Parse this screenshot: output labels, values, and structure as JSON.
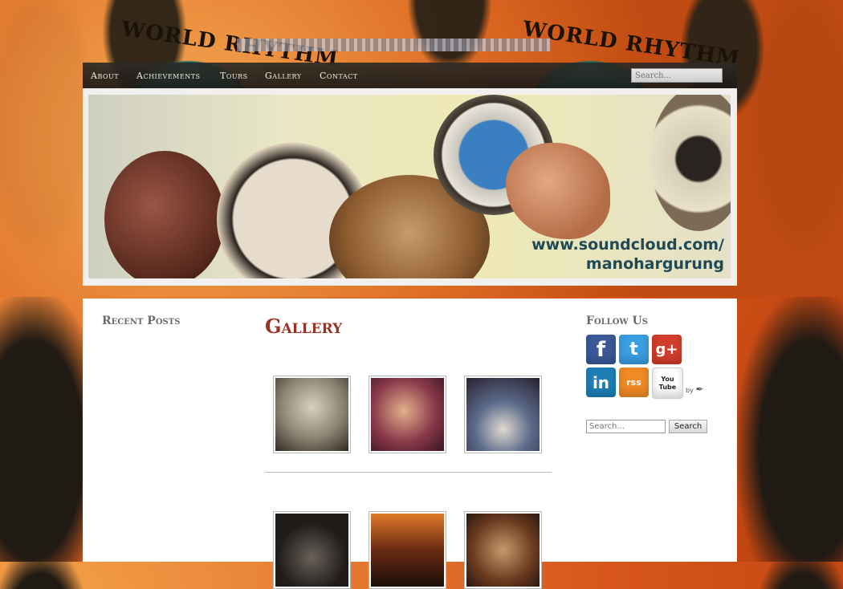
{
  "header": {
    "logo_text": "WORLD RHYTHM",
    "search_placeholder": "Search..."
  },
  "nav": {
    "items": [
      {
        "label": "About"
      },
      {
        "label": "Achievements"
      },
      {
        "label": "Tours"
      },
      {
        "label": "Gallery"
      },
      {
        "label": "Contact"
      }
    ]
  },
  "banner": {
    "line1": "www.soundcloud.com/",
    "line2": "manohargurung"
  },
  "sidebar_left": {
    "title": "Recent Posts"
  },
  "main": {
    "title": "Gallery",
    "row1": [
      {
        "name": "photo-1"
      },
      {
        "name": "photo-2"
      },
      {
        "name": "photo-3"
      }
    ],
    "row2": [
      {
        "name": "photo-4"
      },
      {
        "name": "photo-5"
      },
      {
        "name": "photo-6"
      }
    ]
  },
  "sidebar_right": {
    "title": "Follow Us",
    "social": [
      {
        "label": "f",
        "icon": "facebook-icon",
        "color": "#3b5998"
      },
      {
        "label": "t",
        "icon": "twitter-icon",
        "color": "#3a9ee2"
      },
      {
        "label": "g+",
        "icon": "google-plus-icon",
        "color": "#d23e2b"
      },
      {
        "label": "in",
        "icon": "linkedin-icon",
        "color": "#1d7fb6"
      },
      {
        "label": "rss",
        "icon": "rss-icon",
        "color": "#f08a24"
      },
      {
        "label": "You Tube",
        "icon": "youtube-icon",
        "color": "#ffffff"
      }
    ],
    "credit": "by",
    "search_placeholder": "Search...",
    "search_button": "Search"
  },
  "colors": {
    "accent_title": "#9b3324",
    "navbar": "#1f1b18",
    "banner_text": "#1f4a55"
  }
}
